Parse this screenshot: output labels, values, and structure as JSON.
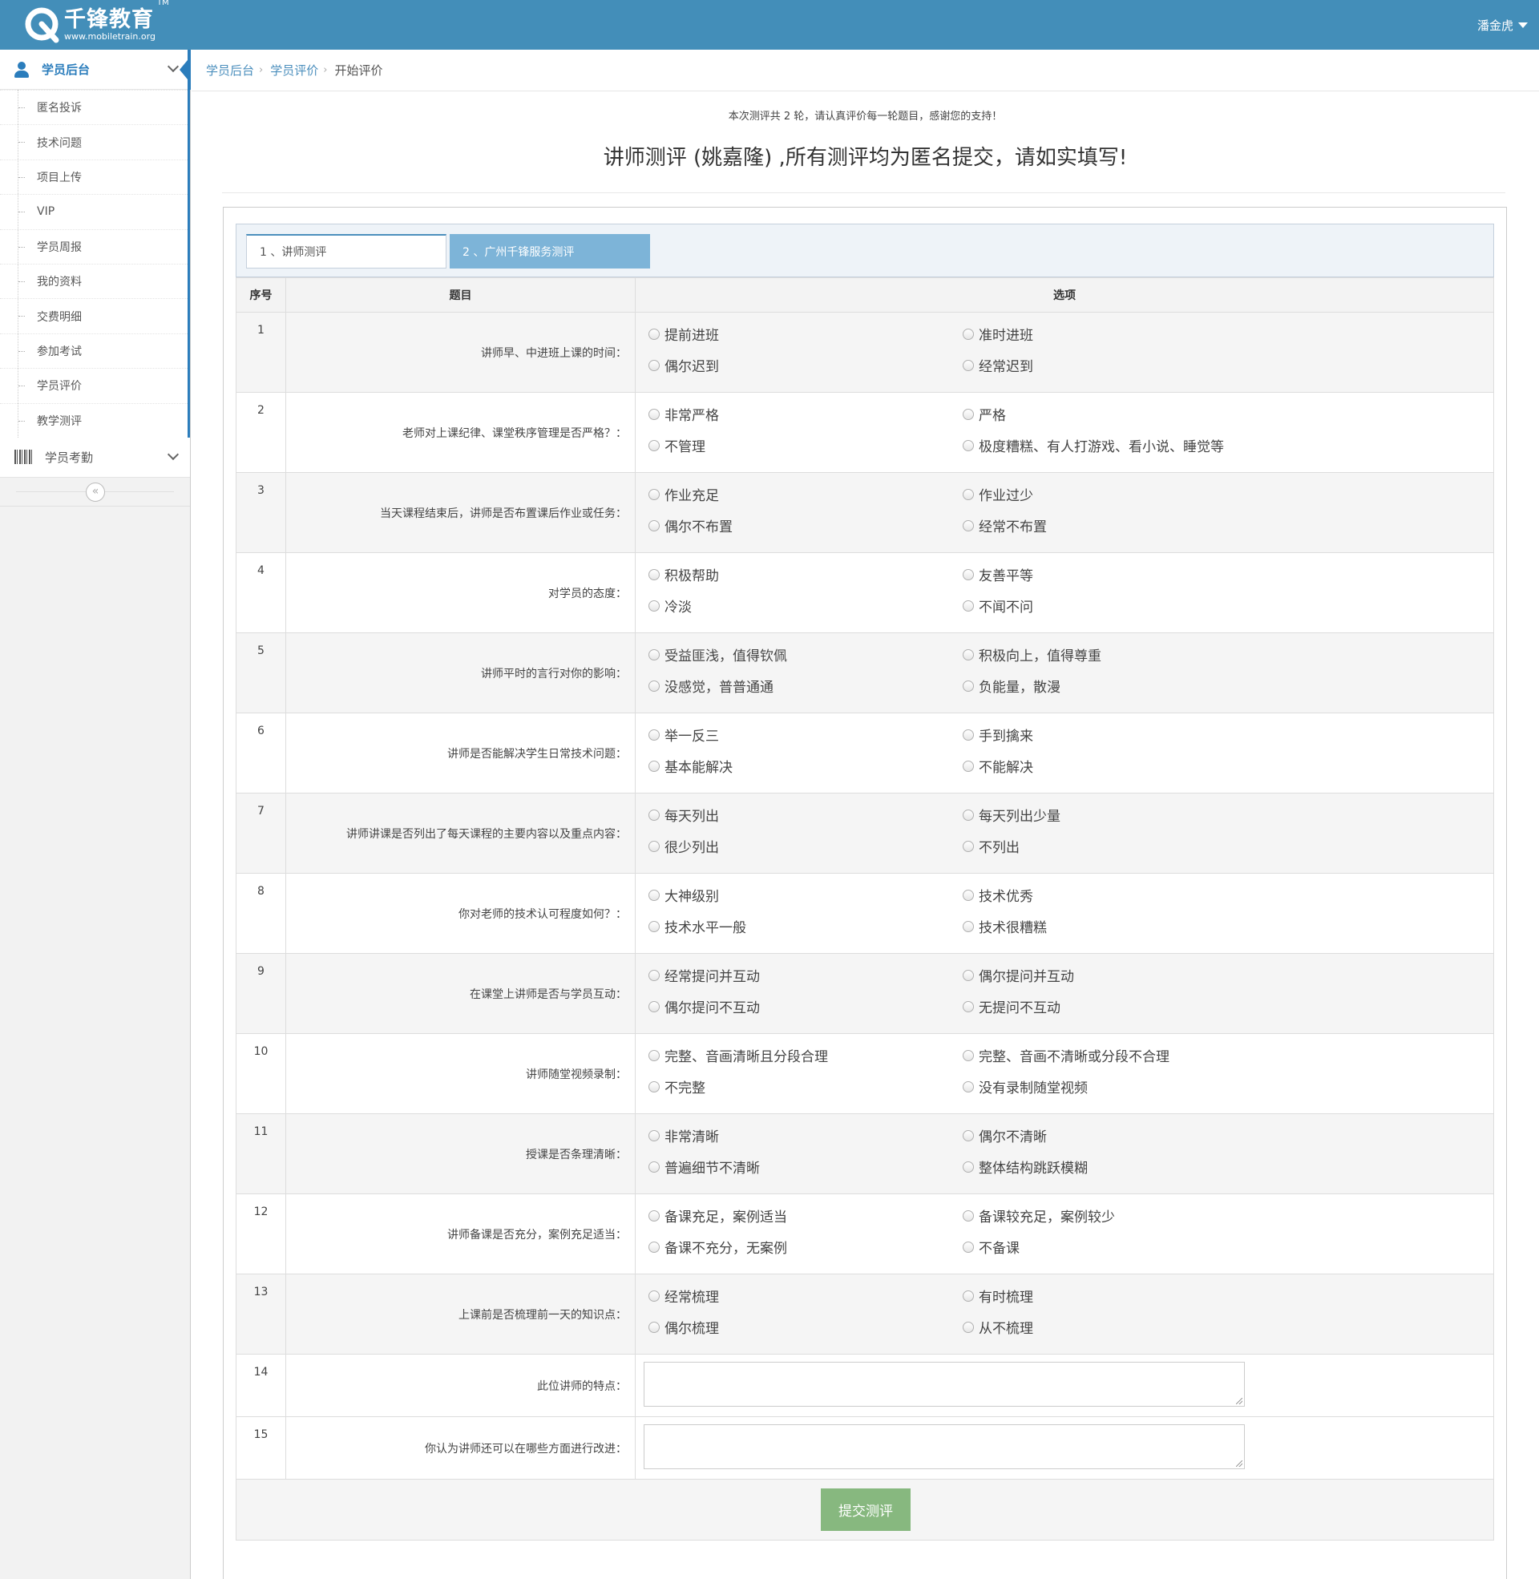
{
  "header": {
    "logo_name": "千锋教育",
    "logo_url": "www.mobiletrain.org",
    "logo_tm": "TM",
    "user_name": "潘金虎"
  },
  "sidebar": {
    "group1_label": "学员后台",
    "items": [
      {
        "label": "匿名投诉"
      },
      {
        "label": "技术问题"
      },
      {
        "label": "项目上传"
      },
      {
        "label": "VIP"
      },
      {
        "label": "学员周报"
      },
      {
        "label": "我的资料"
      },
      {
        "label": "交费明细"
      },
      {
        "label": "参加考试"
      },
      {
        "label": "学员评价"
      },
      {
        "label": "教学测评"
      }
    ],
    "group2_label": "学员考勤",
    "collapse_glyph": "«"
  },
  "breadcrumb": {
    "home": "学员后台",
    "parent": "学员评价",
    "current": "开始评价"
  },
  "notice": "本次测评共 2 轮，请认真评价每一轮题目，感谢您的支持！",
  "title": "讲师测评 (姚嘉隆) ,所有测评均为匿名提交，请如实填写!",
  "tabs": [
    {
      "label": "1 、讲师测评"
    },
    {
      "label": "2 、广州千锋服务测评"
    }
  ],
  "table": {
    "headers": {
      "num": "序号",
      "question": "题目",
      "options": "选项"
    },
    "questions": [
      {
        "num": "1",
        "text": "讲师早、中进班上课的时间：",
        "options": [
          "提前进班",
          "准时进班",
          "偶尔迟到",
          "经常迟到"
        ]
      },
      {
        "num": "2",
        "text": "老师对上课纪律、课堂秩序管理是否严格？：",
        "options": [
          "非常严格",
          "严格",
          "不管理",
          "极度糟糕、有人打游戏、看小说、睡觉等"
        ]
      },
      {
        "num": "3",
        "text": "当天课程结束后，讲师是否布置课后作业或任务：",
        "options": [
          "作业充足",
          "作业过少",
          "偶尔不布置",
          "经常不布置"
        ]
      },
      {
        "num": "4",
        "text": "对学员的态度：",
        "options": [
          "积极帮助",
          "友善平等",
          "冷淡",
          "不闻不问"
        ]
      },
      {
        "num": "5",
        "text": "讲师平时的言行对你的影响：",
        "options": [
          "受益匪浅，值得钦佩",
          "积极向上，值得尊重",
          "没感觉，普普通通",
          "负能量，散漫"
        ]
      },
      {
        "num": "6",
        "text": "讲师是否能解决学生日常技术问题：",
        "options": [
          "举一反三",
          "手到擒来",
          "基本能解决",
          "不能解决"
        ]
      },
      {
        "num": "7",
        "text": "讲师讲课是否列出了每天课程的主要内容以及重点内容：",
        "options": [
          "每天列出",
          "每天列出少量",
          "很少列出",
          "不列出"
        ]
      },
      {
        "num": "8",
        "text": "你对老师的技术认可程度如何？：",
        "options": [
          "大神级别",
          "技术优秀",
          "技术水平一般",
          "技术很糟糕"
        ]
      },
      {
        "num": "9",
        "text": "在课堂上讲师是否与学员互动：",
        "options": [
          "经常提问并互动",
          "偶尔提问并互动",
          "偶尔提问不互动",
          "无提问不互动"
        ]
      },
      {
        "num": "10",
        "text": "讲师随堂视频录制：",
        "options": [
          "完整、音画清晰且分段合理",
          "完整、音画不清晰或分段不合理",
          "不完整",
          "没有录制随堂视频"
        ]
      },
      {
        "num": "11",
        "text": "授课是否条理清晰：",
        "options": [
          "非常清晰",
          "偶尔不清晰",
          "普遍细节不清晰",
          "整体结构跳跃模糊"
        ]
      },
      {
        "num": "12",
        "text": "讲师备课是否充分，案例充足适当：",
        "options": [
          "备课充足，案例适当",
          "备课较充足，案例较少",
          "备课不充分，无案例",
          "不备课"
        ]
      },
      {
        "num": "13",
        "text": "上课前是否梳理前一天的知识点：",
        "options": [
          "经常梳理",
          "有时梳理",
          "偶尔梳理",
          "从不梳理"
        ]
      }
    ],
    "text_questions": [
      {
        "num": "14",
        "text": "此位讲师的特点：",
        "value": ""
      },
      {
        "num": "15",
        "text": "你认为讲师还可以在哪些方面进行改进：",
        "value": ""
      }
    ]
  },
  "submit_label": "提交测评"
}
